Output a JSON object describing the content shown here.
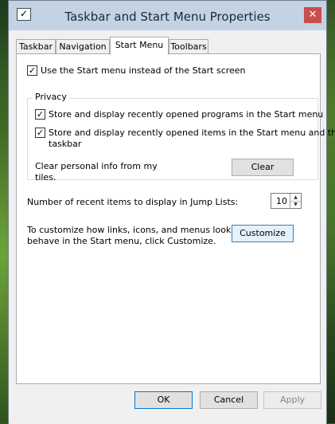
{
  "window": {
    "title": "Taskbar and Start Menu Properties",
    "close_icon": "✕"
  },
  "tabs": [
    {
      "label": "Taskbar"
    },
    {
      "label": "Navigation"
    },
    {
      "label": "Start Menu"
    },
    {
      "label": "Toolbars"
    }
  ],
  "active_tab": "Start Menu",
  "start_menu": {
    "use_start_menu": {
      "label": "Use the Start menu instead of the Start screen",
      "checked": true
    },
    "privacy": {
      "legend": "Privacy",
      "programs": {
        "label": "Store and display recently opened programs in the Start menu",
        "checked": true
      },
      "items": {
        "label_line1": "Store and display recently opened items in the Start menu and the",
        "label_line2": "taskbar",
        "checked": true
      },
      "clear_text_line1": "Clear personal info from my",
      "clear_text_line2": "tiles.",
      "clear_button": "Clear"
    },
    "jump_lists": {
      "label": "Number of recent items to display in Jump Lists:",
      "value": "10"
    },
    "customize": {
      "text_line1": "To customize how links, icons, and menus look and",
      "text_line2": "behave in the Start menu, click Customize.",
      "button": "Customize"
    }
  },
  "footer": {
    "ok": "OK",
    "cancel": "Cancel",
    "apply": "Apply"
  },
  "check_glyph": "✓"
}
